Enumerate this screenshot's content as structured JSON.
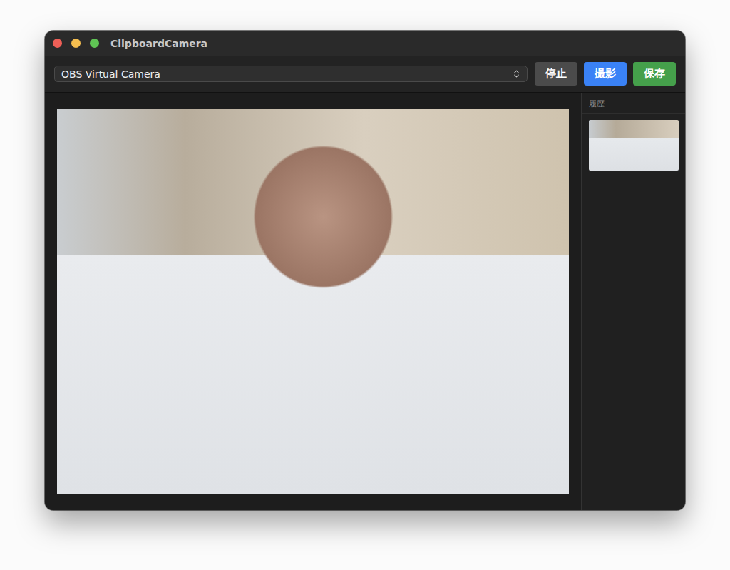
{
  "window": {
    "title": "ClipboardCamera",
    "controls": [
      {
        "name": "close",
        "color": "#ee5f57"
      },
      {
        "name": "minimize",
        "color": "#f5be4f"
      },
      {
        "name": "zoom",
        "color": "#5fc454"
      }
    ]
  },
  "toolbar": {
    "camera_select": {
      "value": "OBS Virtual Camera"
    },
    "buttons": [
      {
        "label": "停止",
        "color": "#4b4b4b"
      },
      {
        "label": "撮影",
        "color": "#3a82f6"
      },
      {
        "label": "保存",
        "color": "#45a04b"
      }
    ]
  },
  "preview": {
    "kind": "photo"
  },
  "history": {
    "title": "履歴",
    "items": [
      {
        "kind": "photo",
        "selected": false
      }
    ]
  }
}
